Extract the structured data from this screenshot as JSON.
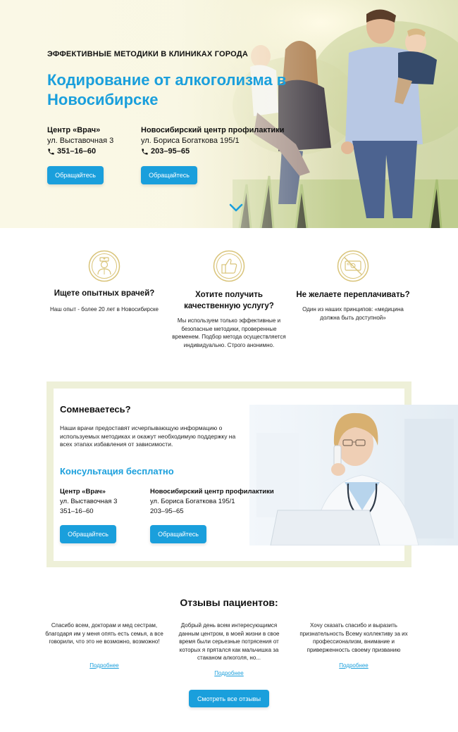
{
  "hero": {
    "eyebrow": "ЭФФЕКТИВНЫЕ МЕТОДИКИ В КЛИНИКАХ ГОРОДА",
    "title": "Кодирование от алкоголизма в Новосибирске",
    "clinics": [
      {
        "name": "Центр «Врач»",
        "address": "ул. Выставочная 3",
        "phone": "351–16–60",
        "button": "Обращайтесь"
      },
      {
        "name": "Новосибирский центр профилактики",
        "address": "ул. Бориса Богаткова 195/1",
        "phone": "203–95–65",
        "button": "Обращайтесь"
      }
    ]
  },
  "features": [
    {
      "icon": "doctor-icon",
      "title": "Ищете опытных врачей?",
      "text": "Наш опыт - более 20 лет в Новосибирске"
    },
    {
      "icon": "thumbs-up-icon",
      "title": "Хотите получить качественную услугу?",
      "text": "Мы используем только эффективные и безопасные методики, проверенные временем. Подбор метода осуществляется индивидуально. Строго анонимно."
    },
    {
      "icon": "no-money-icon",
      "title": "Не желаете переплачивать?",
      "text": "Один из наших принципов: «медицина должна быть доступной»"
    }
  ],
  "doubts": {
    "title": "Сомневаетесь?",
    "text": "Наши врачи предоставят исчерпывающую информацию о используемых методиках и окажут необходимую поддержку на всех этапах избавления от зависимости.",
    "consult_title": "Консультация бесплатно",
    "clinics": [
      {
        "name": "Центр «Врач»",
        "address": "ул. Выставочная 3",
        "phone": "351–16–60",
        "button": "Обращайтесь"
      },
      {
        "name": "Новосибирский центр профилактики",
        "address": "ул. Бориса Богаткова 195/1",
        "phone": "203–95–65",
        "button": "Обращайтесь"
      }
    ]
  },
  "reviews": {
    "heading": "Отзывы пациентов:",
    "items": [
      {
        "text": "Спасибо всем, докторам и мед сестрам, благодаря им у меня опять есть семья, а все говорили, что это не возможно, возможно!",
        "link": "Подробнее"
      },
      {
        "text": "Добрый день всем интересующимся данным центром, в моей жизни в свое время были серьезные потрясения от которых я прятался как мальчишка за стаканом алкоголя, но...",
        "link": "Подробнее"
      },
      {
        "text": "Хочу сказать спасибо и выразить признательность Всему коллективу за их профессионализм, внимание и приверженность своему призванию",
        "link": "Подробнее"
      }
    ],
    "all_button": "Смотреть все отзывы"
  },
  "colors": {
    "accent": "#1a9fdc",
    "icon_gold": "#d9c47a",
    "frame": "#eef0d8"
  }
}
